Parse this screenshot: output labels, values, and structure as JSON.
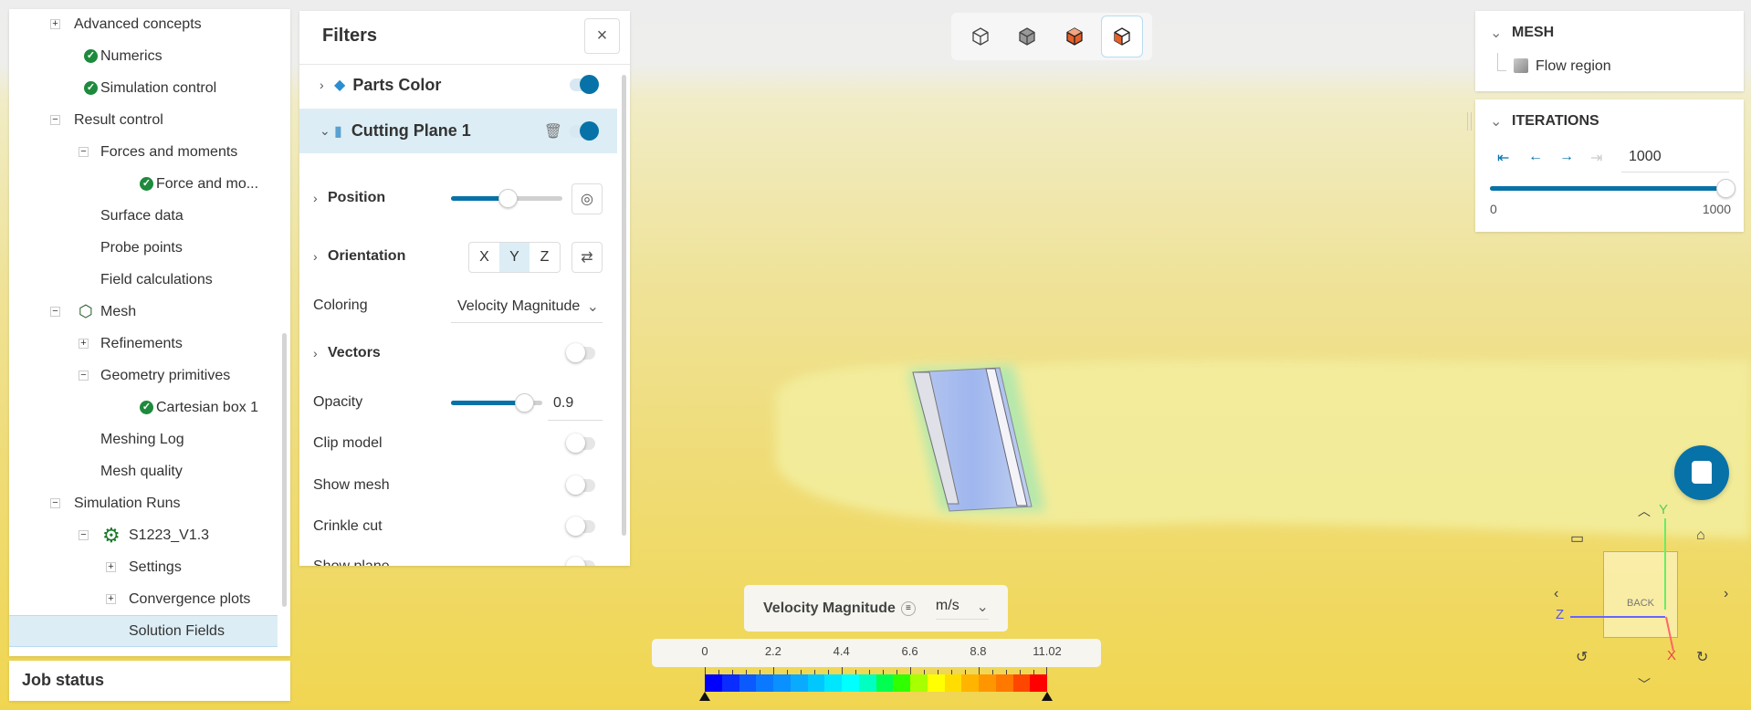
{
  "tree": {
    "items": [
      {
        "label": "Advanced concepts",
        "toggle": "+",
        "icon": ""
      },
      {
        "label": "Numerics",
        "toggle": "",
        "icon": "check"
      },
      {
        "label": "Simulation control",
        "toggle": "",
        "icon": "check"
      },
      {
        "label": "Result control",
        "toggle": "-",
        "icon": ""
      },
      {
        "label": "Forces and moments",
        "toggle": "-",
        "icon": ""
      },
      {
        "label": "Force and mo...",
        "toggle": "",
        "icon": "check"
      },
      {
        "label": "Surface data",
        "toggle": "",
        "icon": ""
      },
      {
        "label": "Probe points",
        "toggle": "",
        "icon": ""
      },
      {
        "label": "Field calculations",
        "toggle": "",
        "icon": ""
      },
      {
        "label": "Mesh",
        "toggle": "-",
        "icon": "mesh"
      },
      {
        "label": "Refinements",
        "toggle": "+",
        "icon": ""
      },
      {
        "label": "Geometry primitives",
        "toggle": "-",
        "icon": ""
      },
      {
        "label": "Cartesian box 1",
        "toggle": "",
        "icon": "check"
      },
      {
        "label": "Meshing Log",
        "toggle": "",
        "icon": ""
      },
      {
        "label": "Mesh quality",
        "toggle": "",
        "icon": ""
      },
      {
        "label": "Simulation Runs",
        "toggle": "-",
        "icon": ""
      },
      {
        "label": "S1223_V1.3",
        "toggle": "-",
        "icon": "gear"
      },
      {
        "label": "Settings",
        "toggle": "+",
        "icon": ""
      },
      {
        "label": "Convergence plots",
        "toggle": "+",
        "icon": ""
      },
      {
        "label": "Solution Fields",
        "toggle": "",
        "icon": "",
        "selected": true
      }
    ]
  },
  "job_status": "Job status",
  "filters": {
    "title": "Filters",
    "parts_color": "Parts Color",
    "cutting_plane": "Cutting Plane 1",
    "position": "Position",
    "position_value": 0.5,
    "orientation": "Orientation",
    "axes": [
      "X",
      "Y",
      "Z"
    ],
    "selected_axis": "Y",
    "coloring_label": "Coloring",
    "coloring_value": "Velocity Magnitude",
    "vectors": "Vectors",
    "opacity_label": "Opacity",
    "opacity_value": "0.9",
    "clip_model": "Clip model",
    "show_mesh": "Show mesh",
    "crinkle_cut": "Crinkle cut",
    "show_plane": "Show plane"
  },
  "mesh_panel": {
    "title": "MESH",
    "item": "Flow region"
  },
  "iterations": {
    "title": "ITERATIONS",
    "value": "1000",
    "min": "0",
    "max": "1000",
    "fraction": 1.0
  },
  "legend": {
    "title": "Velocity Magnitude",
    "unit": "m/s",
    "ticks": [
      "0",
      "2.2",
      "4.4",
      "6.6",
      "8.8",
      "11.02"
    ],
    "colors": [
      "#0000ff",
      "#0a2cff",
      "#0a5aff",
      "#0a78ff",
      "#0a90ff",
      "#0aaaff",
      "#00c8ff",
      "#00e6ff",
      "#00ffff",
      "#00ffc0",
      "#00ff50",
      "#30ff00",
      "#a8ff00",
      "#ffff00",
      "#ffdd00",
      "#ffb400",
      "#ff9600",
      "#ff7800",
      "#ff4600",
      "#ff0000"
    ]
  },
  "viewcube": {
    "face": "BACK",
    "x": "X",
    "y": "Y",
    "z": "Z"
  },
  "accent": "#0772a8"
}
